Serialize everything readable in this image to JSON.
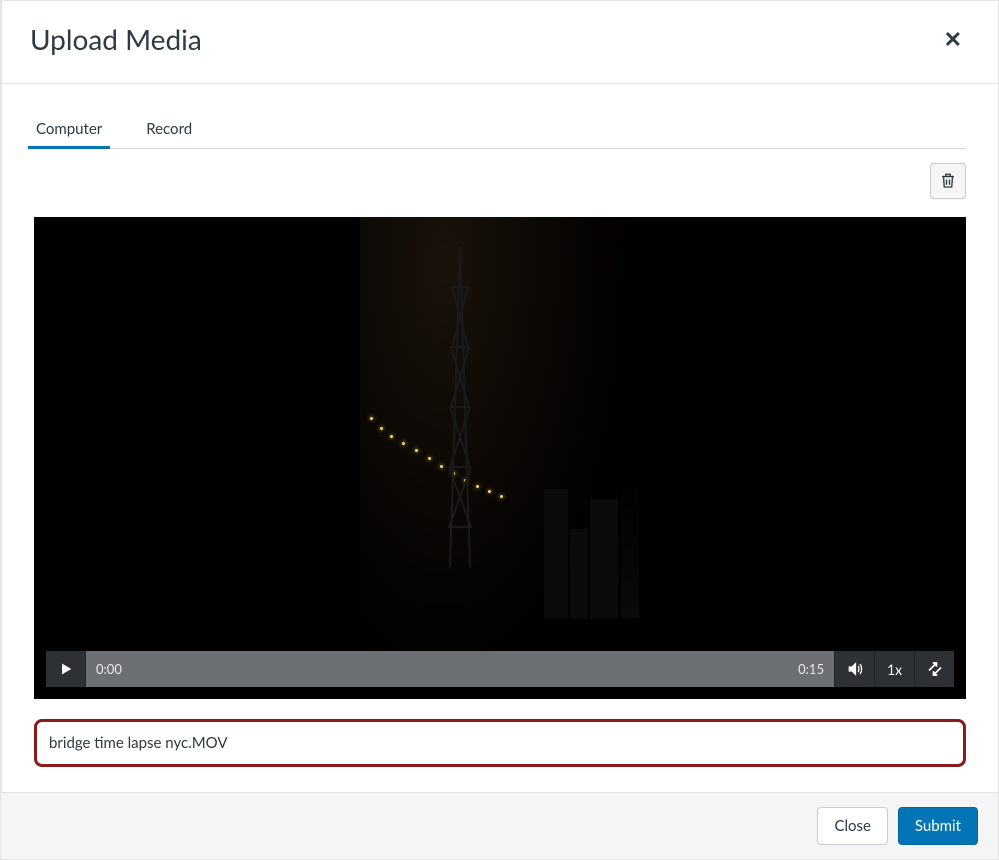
{
  "modal": {
    "title": "Upload Media",
    "close_icon": "close-icon"
  },
  "tabs": [
    {
      "label": "Computer",
      "active": true
    },
    {
      "label": "Record",
      "active": false
    }
  ],
  "toolbar": {
    "delete_icon": "trash-icon"
  },
  "video": {
    "current_time": "0:00",
    "duration": "0:15",
    "speed": "1x"
  },
  "file": {
    "name": "bridge time lapse nyc.MOV"
  },
  "footer": {
    "close_label": "Close",
    "submit_label": "Submit"
  }
}
